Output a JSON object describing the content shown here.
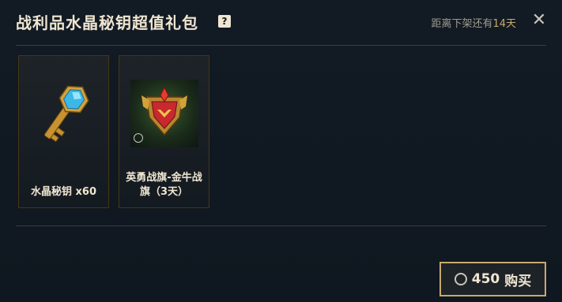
{
  "header": {
    "title": "战利品水晶秘钥超值礼包",
    "help_symbol": "?",
    "countdown_prefix": "距离下架还有",
    "countdown_days": "14天",
    "close_symbol": "✕"
  },
  "items": [
    {
      "label": "水晶秘钥 x60",
      "icon": "crystal-key-icon"
    },
    {
      "label": "英勇战旗-金牛战旗（3天）",
      "icon": "banner-icon"
    }
  ],
  "purchase": {
    "price": "450",
    "label": "购买"
  },
  "colors": {
    "gold": "#c8aa6e",
    "text": "#f0e6d2",
    "background": "#101820"
  }
}
